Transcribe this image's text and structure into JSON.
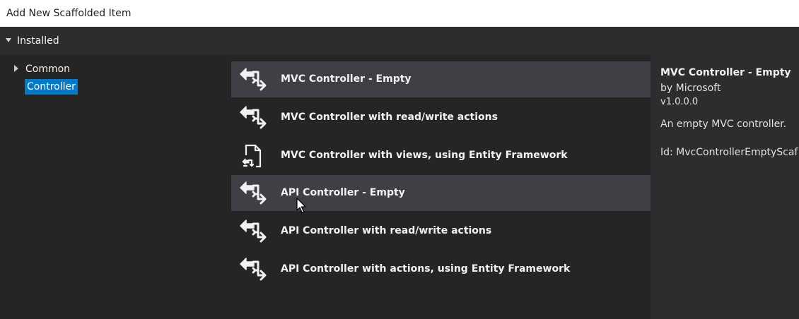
{
  "window": {
    "title": "Add New Scaffolded Item"
  },
  "tree": {
    "header": "Installed",
    "items": [
      {
        "label": "Common"
      },
      {
        "label": "Controller"
      }
    ]
  },
  "templates": [
    {
      "label": "MVC Controller - Empty",
      "icon": "controller-arrows-icon"
    },
    {
      "label": "MVC Controller with read/write actions",
      "icon": "controller-arrows-icon"
    },
    {
      "label": "MVC Controller with views, using Entity Framework",
      "icon": "controller-views-document-icon"
    },
    {
      "label": "API Controller - Empty",
      "icon": "controller-arrows-icon"
    },
    {
      "label": "API Controller with read/write actions",
      "icon": "controller-arrows-icon"
    },
    {
      "label": "API Controller with actions, using Entity Framework",
      "icon": "controller-arrows-icon"
    }
  ],
  "details": {
    "name": "MVC Controller - Empty",
    "author": "by Microsoft",
    "version": "v1.0.0.0",
    "description": "An empty MVC controller.",
    "id": "Id: MvcControllerEmptyScaf"
  },
  "colors": {
    "selection": "#007acc",
    "hover": "#3f3f46",
    "background": "#252526"
  }
}
